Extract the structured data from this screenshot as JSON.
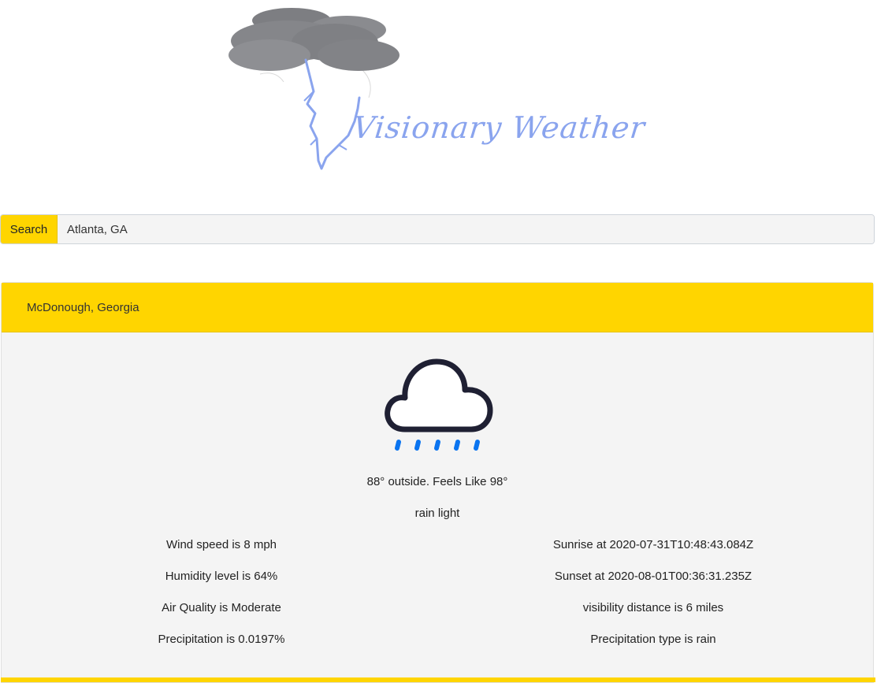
{
  "logo": {
    "text": "Visionary Weather",
    "icon": "storm-cloud-lightning-icon",
    "color": "#8aa4ee"
  },
  "search": {
    "button_label": "Search",
    "value": "Atlanta, GA",
    "placeholder": ""
  },
  "weather": {
    "location": "McDonough, Georgia",
    "icon": "rain-cloud-icon",
    "temperature_line": "88° outside. Feels Like 98°",
    "description": "rain light",
    "details_left": [
      "Wind speed is 8 mph",
      "Humidity level is 64%",
      "Air Quality is Moderate",
      "Precipitation is 0.0197%"
    ],
    "details_right": [
      "Sunrise at 2020-07-31T10:48:43.084Z",
      "Sunset at 2020-08-01T00:36:31.235Z",
      "visibility distance is 6 miles",
      "Precipitation type is rain"
    ]
  },
  "colors": {
    "accent": "#ffd500",
    "card_background": "#f4f4f4",
    "rain_drop": "#0a74f0",
    "cloud_outline": "#1f2033"
  }
}
